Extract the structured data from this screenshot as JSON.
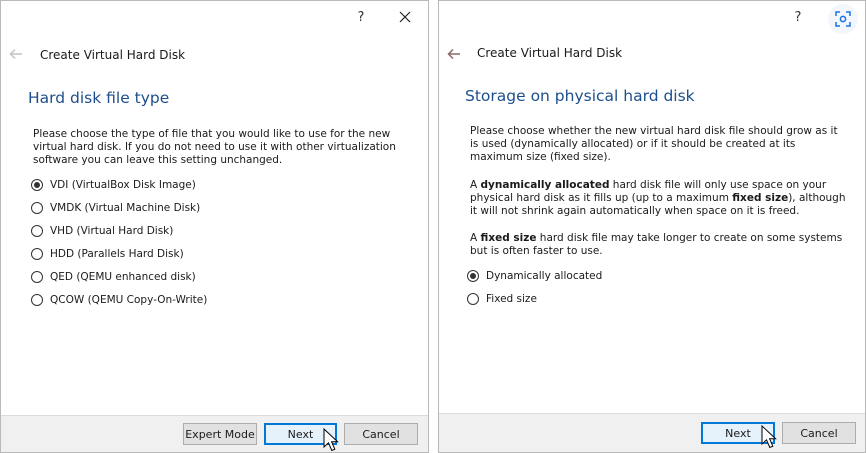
{
  "left_dialog": {
    "help_glyph": "?",
    "close_glyph": "✕",
    "wizard_title": "Create Virtual Hard Disk",
    "heading": "Hard disk file type",
    "description": "Please choose the type of file that you would like to use for the new virtual hard disk. If you do not need to use it with other virtualization software you can leave this setting unchanged.",
    "options": [
      {
        "label": "VDI (VirtualBox Disk Image)",
        "selected": true
      },
      {
        "label": "VMDK (Virtual Machine Disk)",
        "selected": false
      },
      {
        "label": "VHD (Virtual Hard Disk)",
        "selected": false
      },
      {
        "label": "HDD (Parallels Hard Disk)",
        "selected": false
      },
      {
        "label": "QED (QEMU enhanced disk)",
        "selected": false
      },
      {
        "label": "QCOW (QEMU Copy-On-Write)",
        "selected": false
      }
    ],
    "buttons": {
      "expert": "Expert Mode",
      "next": "Next",
      "cancel": "Cancel"
    }
  },
  "right_dialog": {
    "help_glyph": "?",
    "close_glyph": "✕",
    "wizard_title": "Create Virtual Hard Disk",
    "heading": "Storage on physical hard disk",
    "paragraph1": "Please choose whether the new virtual hard disk file should grow as it is used (dynamically allocated) or if it should be created at its maximum size (fixed size).",
    "paragraph2": {
      "a": "A ",
      "b": "dynamically allocated",
      "c": " hard disk file will only use space on your physical hard disk as it fills up (up to a maximum ",
      "d": "fixed size",
      "e": "), although it will not shrink again automatically when space on it is freed."
    },
    "paragraph3": {
      "a": "A ",
      "b": "fixed size",
      "c": " hard disk file may take longer to create on some systems but is often faster to use."
    },
    "options": [
      {
        "label": "Dynamically allocated",
        "selected": true
      },
      {
        "label": "Fixed size",
        "selected": false
      }
    ],
    "buttons": {
      "next": "Next",
      "cancel": "Cancel"
    }
  },
  "icons": {
    "back": "back-arrow-icon",
    "close": "close-icon",
    "help": "help-icon",
    "cursor": "mouse-pointer-icon",
    "badge": "screenshot-capture-icon"
  },
  "colors": {
    "heading": "#1e4f8c",
    "default_button_border": "#0078d7",
    "footer": "#f0f0f0"
  }
}
